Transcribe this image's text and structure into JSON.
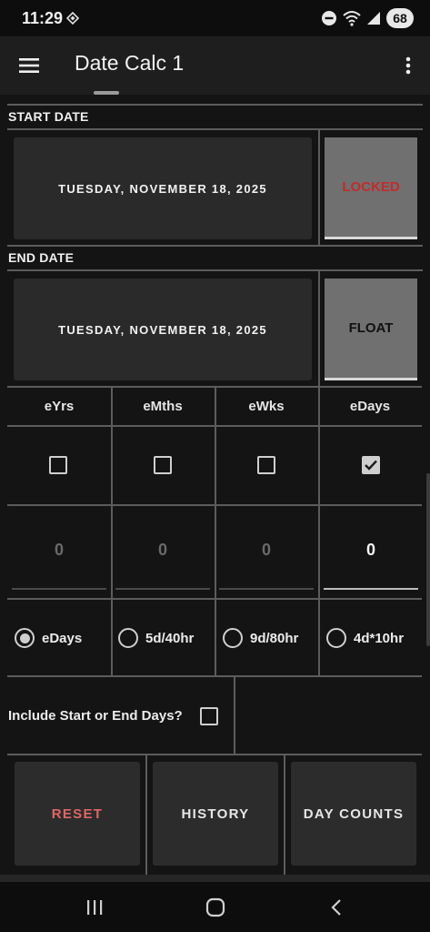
{
  "status_bar": {
    "time": "11:29",
    "battery": "68"
  },
  "app_bar": {
    "title": "Date Calc 1"
  },
  "start_date": {
    "label": "START DATE",
    "value": "TUESDAY, NOVEMBER 18, 2025",
    "mode": "LOCKED"
  },
  "end_date": {
    "label": "END DATE",
    "value": "TUESDAY, NOVEMBER 18, 2025",
    "mode": "FLOAT"
  },
  "units": {
    "headers": [
      "eYrs",
      "eMths",
      "eWks",
      "eDays"
    ],
    "checked": [
      false,
      false,
      false,
      true
    ],
    "values": [
      "0",
      "0",
      "0",
      "0"
    ]
  },
  "schedule": {
    "options": [
      "eDays",
      "5d/40hr",
      "9d/80hr",
      "4d*10hr"
    ],
    "selected": "eDays"
  },
  "include_days": {
    "label": "Include Start or End Days?",
    "checked": false
  },
  "actions": {
    "reset": "RESET",
    "history": "HISTORY",
    "day_counts": "DAY COUNTS"
  },
  "colors": {
    "accent_red": "#e06666",
    "locked_red": "#c42b2b",
    "background": "#141414"
  }
}
